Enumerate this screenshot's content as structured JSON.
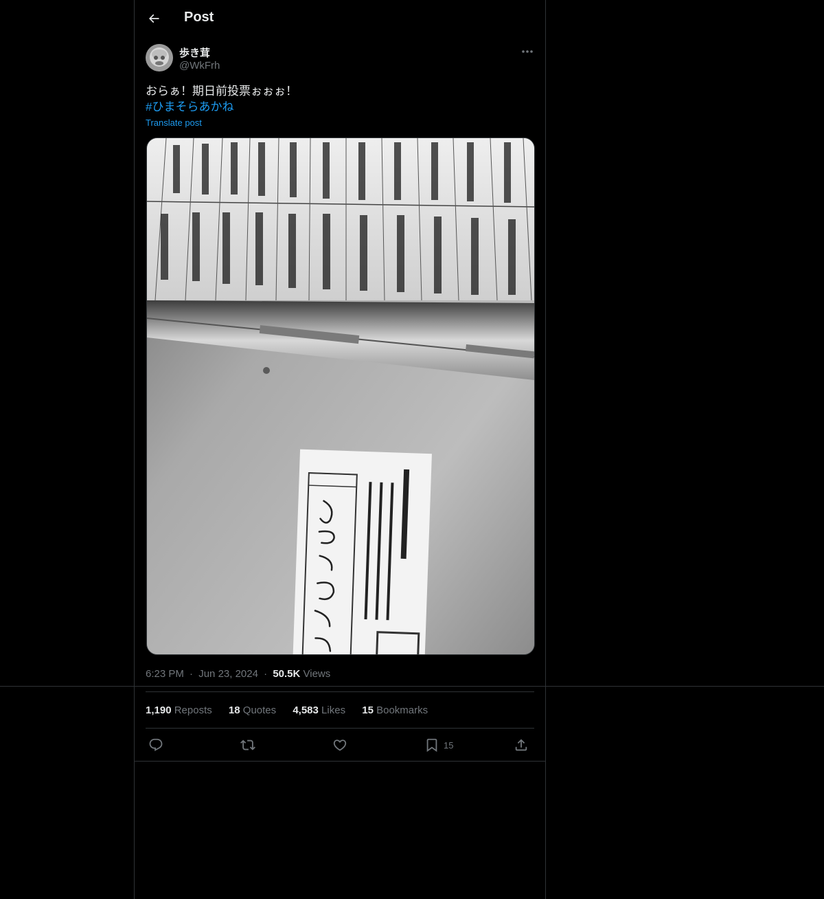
{
  "header": {
    "title": "Post",
    "back_icon": "arrow-left-icon"
  },
  "author": {
    "display_name": "歩き茸",
    "handle": "@WkFrh"
  },
  "post": {
    "text": "おらぁ！期日前投票ぉぉぉ！",
    "hashtag": "#ひまそらあかね",
    "translate_label": "Translate post"
  },
  "meta": {
    "time": "6:23 PM",
    "separator": "·",
    "date": "Jun 23, 2024",
    "views_count": "50.5K",
    "views_label": "Views"
  },
  "stats": [
    {
      "count": "1,190",
      "label": "Reposts"
    },
    {
      "count": "18",
      "label": "Quotes"
    },
    {
      "count": "4,583",
      "label": "Likes"
    },
    {
      "count": "15",
      "label": "Bookmarks"
    }
  ],
  "actions": {
    "reply_icon": "reply-icon",
    "repost_icon": "repost-icon",
    "like_icon": "heart-icon",
    "bookmark_icon": "bookmark-icon",
    "bookmark_count": "15",
    "share_icon": "share-icon"
  },
  "colors": {
    "background": "#000000",
    "text": "#e7e9ea",
    "muted": "#71767b",
    "accent": "#1d9bf0",
    "border": "#2f3336"
  }
}
